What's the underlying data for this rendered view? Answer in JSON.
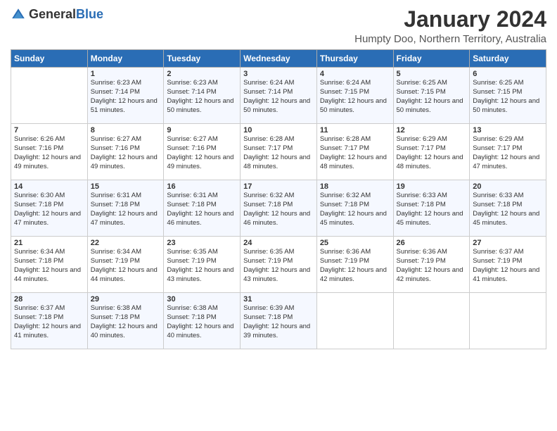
{
  "header": {
    "logo_general": "General",
    "logo_blue": "Blue",
    "month_title": "January 2024",
    "location": "Humpty Doo, Northern Territory, Australia"
  },
  "days_of_week": [
    "Sunday",
    "Monday",
    "Tuesday",
    "Wednesday",
    "Thursday",
    "Friday",
    "Saturday"
  ],
  "weeks": [
    [
      {
        "day": "",
        "sunrise": "",
        "sunset": "",
        "daylight": ""
      },
      {
        "day": "1",
        "sunrise": "Sunrise: 6:23 AM",
        "sunset": "Sunset: 7:14 PM",
        "daylight": "Daylight: 12 hours and 51 minutes."
      },
      {
        "day": "2",
        "sunrise": "Sunrise: 6:23 AM",
        "sunset": "Sunset: 7:14 PM",
        "daylight": "Daylight: 12 hours and 50 minutes."
      },
      {
        "day": "3",
        "sunrise": "Sunrise: 6:24 AM",
        "sunset": "Sunset: 7:14 PM",
        "daylight": "Daylight: 12 hours and 50 minutes."
      },
      {
        "day": "4",
        "sunrise": "Sunrise: 6:24 AM",
        "sunset": "Sunset: 7:15 PM",
        "daylight": "Daylight: 12 hours and 50 minutes."
      },
      {
        "day": "5",
        "sunrise": "Sunrise: 6:25 AM",
        "sunset": "Sunset: 7:15 PM",
        "daylight": "Daylight: 12 hours and 50 minutes."
      },
      {
        "day": "6",
        "sunrise": "Sunrise: 6:25 AM",
        "sunset": "Sunset: 7:15 PM",
        "daylight": "Daylight: 12 hours and 50 minutes."
      }
    ],
    [
      {
        "day": "7",
        "sunrise": "Sunrise: 6:26 AM",
        "sunset": "Sunset: 7:16 PM",
        "daylight": "Daylight: 12 hours and 49 minutes."
      },
      {
        "day": "8",
        "sunrise": "Sunrise: 6:27 AM",
        "sunset": "Sunset: 7:16 PM",
        "daylight": "Daylight: 12 hours and 49 minutes."
      },
      {
        "day": "9",
        "sunrise": "Sunrise: 6:27 AM",
        "sunset": "Sunset: 7:16 PM",
        "daylight": "Daylight: 12 hours and 49 minutes."
      },
      {
        "day": "10",
        "sunrise": "Sunrise: 6:28 AM",
        "sunset": "Sunset: 7:17 PM",
        "daylight": "Daylight: 12 hours and 48 minutes."
      },
      {
        "day": "11",
        "sunrise": "Sunrise: 6:28 AM",
        "sunset": "Sunset: 7:17 PM",
        "daylight": "Daylight: 12 hours and 48 minutes."
      },
      {
        "day": "12",
        "sunrise": "Sunrise: 6:29 AM",
        "sunset": "Sunset: 7:17 PM",
        "daylight": "Daylight: 12 hours and 48 minutes."
      },
      {
        "day": "13",
        "sunrise": "Sunrise: 6:29 AM",
        "sunset": "Sunset: 7:17 PM",
        "daylight": "Daylight: 12 hours and 47 minutes."
      }
    ],
    [
      {
        "day": "14",
        "sunrise": "Sunrise: 6:30 AM",
        "sunset": "Sunset: 7:18 PM",
        "daylight": "Daylight: 12 hours and 47 minutes."
      },
      {
        "day": "15",
        "sunrise": "Sunrise: 6:31 AM",
        "sunset": "Sunset: 7:18 PM",
        "daylight": "Daylight: 12 hours and 47 minutes."
      },
      {
        "day": "16",
        "sunrise": "Sunrise: 6:31 AM",
        "sunset": "Sunset: 7:18 PM",
        "daylight": "Daylight: 12 hours and 46 minutes."
      },
      {
        "day": "17",
        "sunrise": "Sunrise: 6:32 AM",
        "sunset": "Sunset: 7:18 PM",
        "daylight": "Daylight: 12 hours and 46 minutes."
      },
      {
        "day": "18",
        "sunrise": "Sunrise: 6:32 AM",
        "sunset": "Sunset: 7:18 PM",
        "daylight": "Daylight: 12 hours and 45 minutes."
      },
      {
        "day": "19",
        "sunrise": "Sunrise: 6:33 AM",
        "sunset": "Sunset: 7:18 PM",
        "daylight": "Daylight: 12 hours and 45 minutes."
      },
      {
        "day": "20",
        "sunrise": "Sunrise: 6:33 AM",
        "sunset": "Sunset: 7:18 PM",
        "daylight": "Daylight: 12 hours and 45 minutes."
      }
    ],
    [
      {
        "day": "21",
        "sunrise": "Sunrise: 6:34 AM",
        "sunset": "Sunset: 7:18 PM",
        "daylight": "Daylight: 12 hours and 44 minutes."
      },
      {
        "day": "22",
        "sunrise": "Sunrise: 6:34 AM",
        "sunset": "Sunset: 7:19 PM",
        "daylight": "Daylight: 12 hours and 44 minutes."
      },
      {
        "day": "23",
        "sunrise": "Sunrise: 6:35 AM",
        "sunset": "Sunset: 7:19 PM",
        "daylight": "Daylight: 12 hours and 43 minutes."
      },
      {
        "day": "24",
        "sunrise": "Sunrise: 6:35 AM",
        "sunset": "Sunset: 7:19 PM",
        "daylight": "Daylight: 12 hours and 43 minutes."
      },
      {
        "day": "25",
        "sunrise": "Sunrise: 6:36 AM",
        "sunset": "Sunset: 7:19 PM",
        "daylight": "Daylight: 12 hours and 42 minutes."
      },
      {
        "day": "26",
        "sunrise": "Sunrise: 6:36 AM",
        "sunset": "Sunset: 7:19 PM",
        "daylight": "Daylight: 12 hours and 42 minutes."
      },
      {
        "day": "27",
        "sunrise": "Sunrise: 6:37 AM",
        "sunset": "Sunset: 7:19 PM",
        "daylight": "Daylight: 12 hours and 41 minutes."
      }
    ],
    [
      {
        "day": "28",
        "sunrise": "Sunrise: 6:37 AM",
        "sunset": "Sunset: 7:18 PM",
        "daylight": "Daylight: 12 hours and 41 minutes."
      },
      {
        "day": "29",
        "sunrise": "Sunrise: 6:38 AM",
        "sunset": "Sunset: 7:18 PM",
        "daylight": "Daylight: 12 hours and 40 minutes."
      },
      {
        "day": "30",
        "sunrise": "Sunrise: 6:38 AM",
        "sunset": "Sunset: 7:18 PM",
        "daylight": "Daylight: 12 hours and 40 minutes."
      },
      {
        "day": "31",
        "sunrise": "Sunrise: 6:39 AM",
        "sunset": "Sunset: 7:18 PM",
        "daylight": "Daylight: 12 hours and 39 minutes."
      },
      {
        "day": "",
        "sunrise": "",
        "sunset": "",
        "daylight": ""
      },
      {
        "day": "",
        "sunrise": "",
        "sunset": "",
        "daylight": ""
      },
      {
        "day": "",
        "sunrise": "",
        "sunset": "",
        "daylight": ""
      }
    ]
  ]
}
